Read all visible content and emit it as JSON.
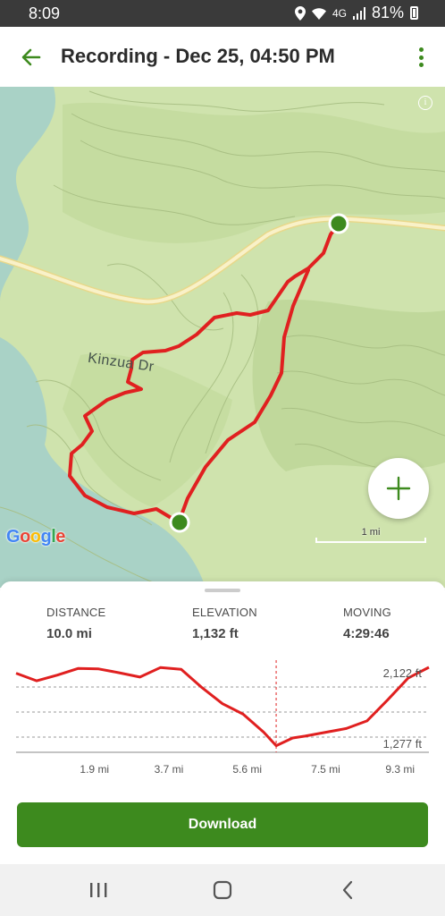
{
  "status_bar": {
    "time": "8:09",
    "network": "4G",
    "battery": "81%",
    "icons": [
      "location-icon",
      "wifi-icon",
      "signal-icon",
      "battery-icon"
    ]
  },
  "app_bar": {
    "title": "Recording - Dec 25, 04:50 PM",
    "back_icon": "arrow-back-icon",
    "menu_icon": "more-vert-icon"
  },
  "map": {
    "road_label": "Kinzua Dr",
    "attribution": "Google",
    "scale_label": "1 mi",
    "info_icon": "info-icon",
    "zoom_icon": "plus-icon",
    "track_color": "#e02020",
    "endpoint_color": "#3d8a1e"
  },
  "stats": {
    "distance": {
      "label": "DISTANCE",
      "value": "10.0 mi"
    },
    "elevation": {
      "label": "ELEVATION",
      "value": "1,132 ft"
    },
    "moving": {
      "label": "MOVING",
      "value": "4:29:46"
    }
  },
  "chart_data": {
    "type": "line",
    "x_unit": "mi",
    "y_unit": "ft",
    "x_ticks": [
      "1.9 mi",
      "3.7 mi",
      "5.6 mi",
      "7.5 mi",
      "9.3 mi"
    ],
    "y_labels": {
      "max": "2,122 ft",
      "min": "1,277 ft"
    },
    "xlim": [
      0,
      10.0
    ],
    "ylim": [
      1277,
      2122
    ],
    "marker_x": 6.3,
    "series": [
      {
        "color": "#e02020",
        "x": [
          0,
          0.5,
          1.0,
          1.5,
          2.0,
          2.5,
          3.0,
          3.5,
          4.0,
          4.5,
          5.0,
          5.5,
          6.0,
          6.3,
          6.7,
          7.0,
          7.5,
          8.0,
          8.5,
          9.0,
          9.5,
          10.0
        ],
        "y": [
          2060,
          1980,
          2040,
          2110,
          2105,
          2065,
          2020,
          2120,
          2100,
          1910,
          1740,
          1630,
          1440,
          1300,
          1380,
          1400,
          1440,
          1480,
          1560,
          1780,
          2010,
          2122
        ]
      }
    ]
  },
  "actions": {
    "download_label": "Download"
  },
  "nav_bar": {
    "icons": [
      "recent-apps-icon",
      "home-icon",
      "back-icon"
    ]
  }
}
